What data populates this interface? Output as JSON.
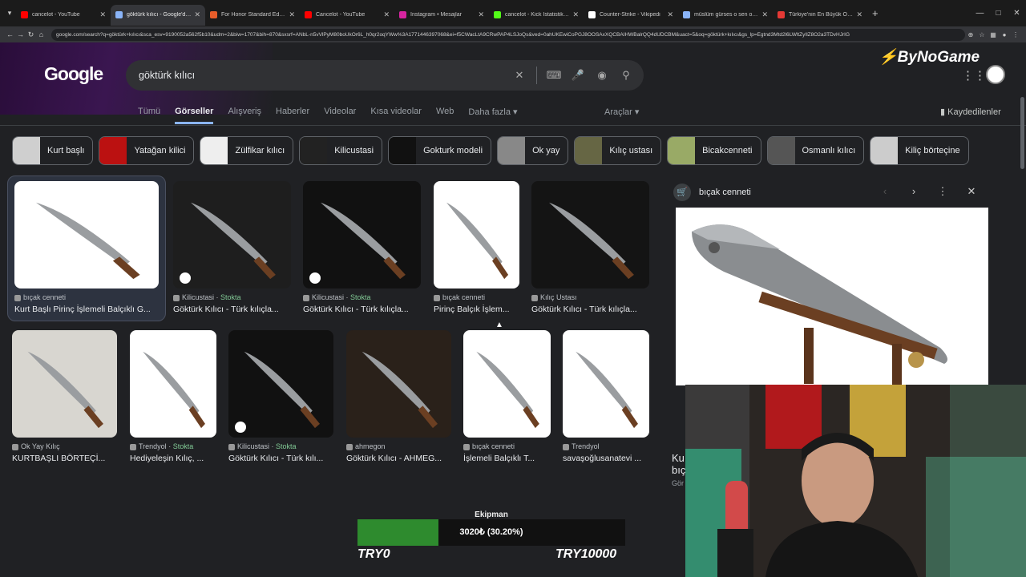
{
  "tabs": [
    {
      "title": "cancelot - YouTube",
      "color": "#ff0000"
    },
    {
      "title": "göktürk kılıcı - Google'da Ara",
      "color": "#8ab4f8",
      "active": true
    },
    {
      "title": "For Honor Standard Edition | E",
      "color": "#e85d2a"
    },
    {
      "title": "Cancelot - YouTube",
      "color": "#ff0000"
    },
    {
      "title": "Instagram • Mesajlar",
      "color": "#d6249f"
    },
    {
      "title": "cancelot - Kick İstatistikleri",
      "color": "#53fc18"
    },
    {
      "title": "Counter-Strike - Vikipedi",
      "color": "#ffffff"
    },
    {
      "title": "müslüm gürses o sen olsan ba",
      "color": "#8ab4f8"
    },
    {
      "title": "Türkiye'nin En Büyük Oyuncu P",
      "color": "#e53935"
    }
  ],
  "url": "google.com/search?q=göktürk+kılıcı&sca_esv=9190052a562f5b10&udm=2&biw=1707&bih=870&sxsrf=ANbL-n5vVlPyM80boUkOr6L_h0qr2oqYWw%3A1771446397068&ei=f5CWacLtA9CRwPAP4LSJoQs&ved=0ahUKEwiCoPGJ8OOSAxXQCBAIHWBalrQQ4dUDCBM&uact=5&oq=göktürk+kılıcı&gs_lp=Egtnd3Mtd2l6LWltZyIlZ8O2a3TDvHJrIG",
  "google": {
    "logo": "Google",
    "query": "göktürk kılıcı",
    "brand": "ByNoGame"
  },
  "nav": {
    "tabs": [
      "Tümü",
      "Görseller",
      "Alışveriş",
      "Haberler",
      "Videolar",
      "Kısa videolar",
      "Web",
      "Daha fazla"
    ],
    "tools": "Araçlar",
    "saved": "Kaydedilenler"
  },
  "chips": [
    "Kurt başlı",
    "Yatağan kilici",
    "Zülfikar kılıcı",
    "Kilicustasi",
    "Gokturk modeli",
    "Ok yay",
    "Kılıç ustası",
    "Bicakcenneti",
    "Osmanlı kılıcı",
    "Kiliç börteçine"
  ],
  "results": [
    {
      "source": "bıçak cenneti",
      "stock": "",
      "title": "Kurt Başlı Pirinç İşlemeli Balçıklı G..."
    },
    {
      "source": "Kilicustasi",
      "stock": "Stokta",
      "title": "Göktürk Kılıcı - Türk kılıçla..."
    },
    {
      "source": "Kilicustasi",
      "stock": "Stokta",
      "title": "Göktürk Kılıcı - Türk kılıçla..."
    },
    {
      "source": "bıçak cenneti",
      "stock": "",
      "title": "Pirinç Balçık İşlem..."
    },
    {
      "source": "Kılıç Ustası",
      "stock": "",
      "title": "Göktürk Kılıcı - Türk kılıçla..."
    },
    {
      "source": "Ok Yay Kılıç",
      "stock": "",
      "title": "KURTBAŞLI BÖRTEÇİ..."
    },
    {
      "source": "Trendyol",
      "stock": "Stokta",
      "title": "Hediyeleşin Kılıç, ..."
    },
    {
      "source": "Kilicustasi",
      "stock": "Stokta",
      "title": "Göktürk Kılıcı - Türk kılı..."
    },
    {
      "source": "ahmegon",
      "stock": "",
      "title": "Göktürk Kılıcı - AHMEG..."
    },
    {
      "source": "bıçak cenneti",
      "stock": "",
      "title": "İşlemeli Balçıklı T..."
    },
    {
      "source": "Trendyol",
      "stock": "",
      "title": "savaşoğlusanatevi ..."
    }
  ],
  "panel": {
    "source": "bıçak cenneti",
    "title_start": "Ku",
    "title_start2": "bıç",
    "subtitle": "Gör"
  },
  "overlay": {
    "label": "Ekipman",
    "progress_text": "3020₺ (30.20%)",
    "progress": 0.302,
    "min_label": "TRY0",
    "max_label": "TRY10000"
  }
}
